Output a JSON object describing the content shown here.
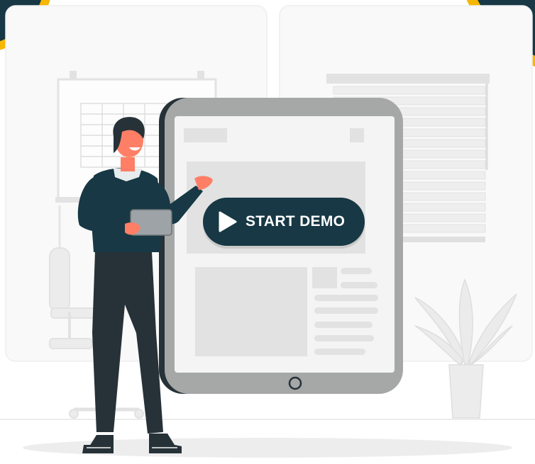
{
  "cta": {
    "label": "START DEMO",
    "icon": "play-icon"
  },
  "colors": {
    "accent_yellow": "#f5b700",
    "dark_teal": "#173844",
    "device_frame": "#a6a8a8",
    "device_screen": "#f4f4f4",
    "placeholder_gray": "#e2e2e2",
    "background_panel": "#f7f7f7"
  }
}
